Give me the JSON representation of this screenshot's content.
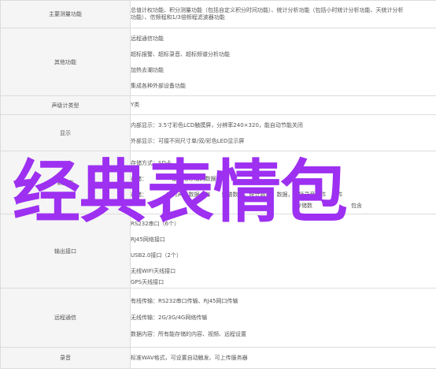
{
  "rows": [
    {
      "label": "主要测量功能",
      "lines": [
        "总值计权功能、积分测量功能（包括自定义积分时间功能）、统计分析功能（包括小时统计分析功能、天统计分析",
        "功能）、信频程和1/3倍频程滤波器功能"
      ]
    },
    {
      "label": "其他功能",
      "lines": [
        "远程通信功能",
        "超标报警、超标录音、超标频谱分析功能",
        "加热去潮功能",
        "集成各种外部设备功能"
      ]
    },
    {
      "label": "声级计类型",
      "lines": [
        "Y类"
      ]
    },
    {
      "label": "显示",
      "lines": [
        "内部显示：3.5寸彩色LCD触摸屏，分辨率240×320，能自动节能关闭",
        "外部显示：可接不同尺寸单/双/彩色LED显示屏"
      ]
    },
    {
      "label": "数据存",
      "lines": [
        "存储方式：SD卡",
        "存储：　　　　　能删除存储的数据文件",
        "存储：　　　　实时声音数据，每　　频谱数据，统计数据　数据，包括录音文件　事件",
        "　　　　　　　　　　　　　　　　　　　　　　　　　　　　　　存储数　　　　　　　包含"
      ]
    },
    {
      "label": "输出接口",
      "lines": [
        "RS232串口（6个）",
        "RJ45网络接口",
        "USB2.0接口（2个）",
        "无线WIFI天线接口",
        "GPS天线接口"
      ]
    },
    {
      "label": "远程通信",
      "lines": [
        "有线传输：RS232串口传输、RJ45网口传输",
        "无线传输：2G/3G/4G网络传输",
        "数据内容：所有能存储的内容、视频、远程设置"
      ]
    },
    {
      "label": "录音",
      "lines": [
        "标准WAV格式，可设置自动触发、可上传服务器"
      ]
    }
  ],
  "overlay_text": "经典表情包"
}
